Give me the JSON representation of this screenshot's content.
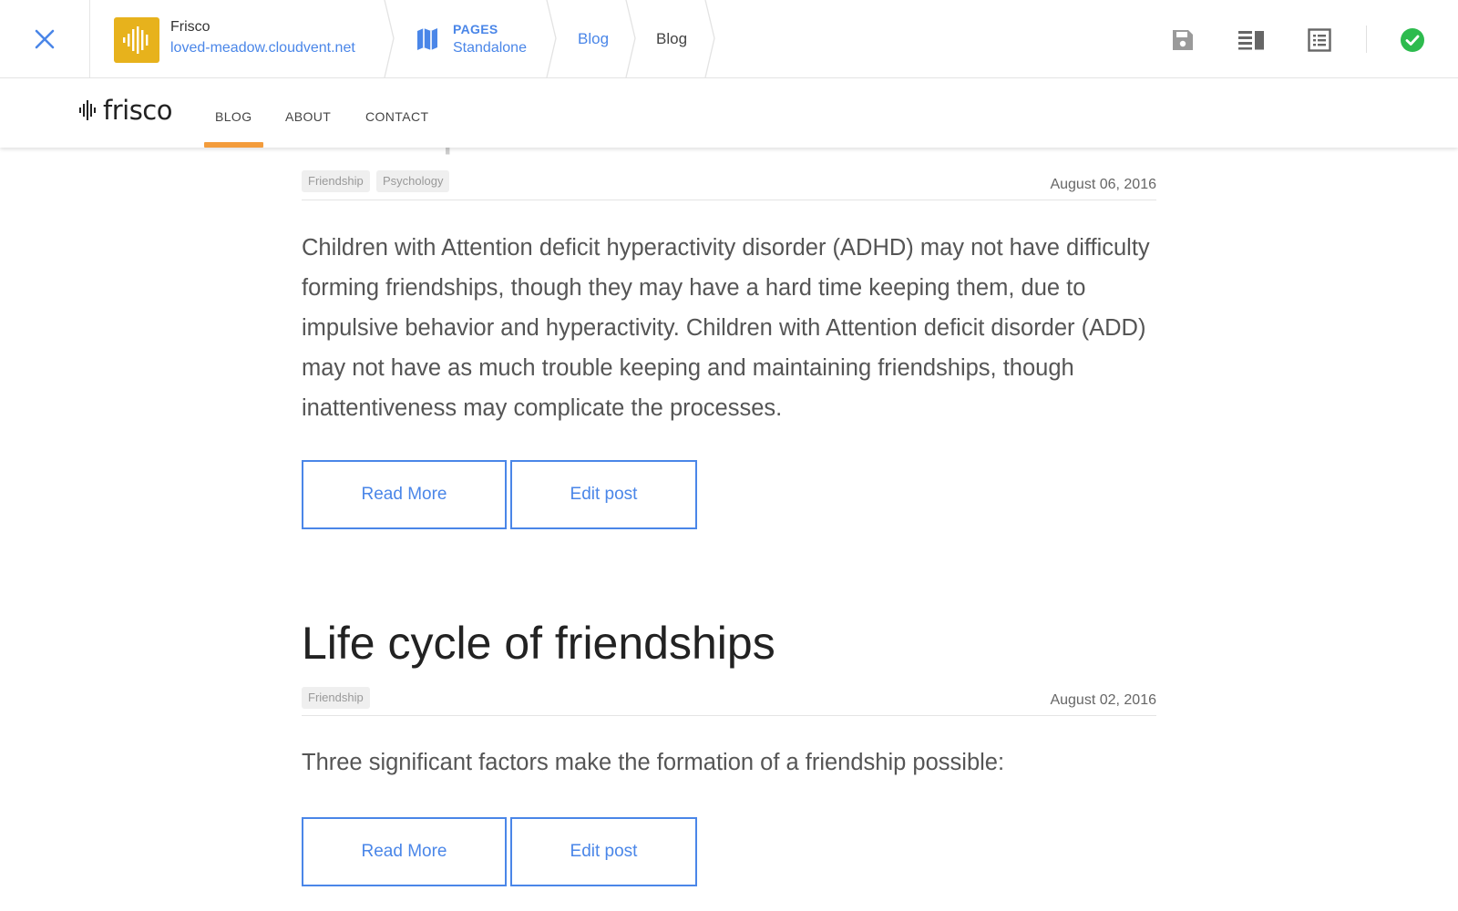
{
  "editor": {
    "site_name": "Frisco",
    "site_url": "loved-meadow.cloudvent.net",
    "pages_label": "PAGES",
    "pages_sub": "Standalone",
    "crumb_blog_link": "Blog",
    "crumb_blog_current": "Blog",
    "icons": [
      "close-icon",
      "site-logo-icon",
      "map-icon",
      "save-icon",
      "layout-icon",
      "list-icon",
      "check-circle-icon"
    ],
    "accent_color": "#4a86e8",
    "success_color": "#2dbb4e",
    "logo_color": "#e7b21c"
  },
  "site_nav": {
    "brand": "frisco",
    "items": [
      {
        "label": "BLOG"
      },
      {
        "label": "ABOUT"
      },
      {
        "label": "CONTACT"
      }
    ],
    "active_color": "#f39c3c"
  },
  "posts": [
    {
      "ghost_title": "Development Issues",
      "tags": [
        "Friendship",
        "Psychology"
      ],
      "date": "August 06, 2016",
      "body": "Children with Attention deficit hyperactivity disorder (ADHD) may not have difficulty forming friendships, though they may have a hard time keeping them, due to impulsive behavior and hyperactivity. Children with Attention deficit disorder (ADD) may not have as much trouble keeping and maintaining friendships, though inattentiveness may complicate the processes.",
      "read_more": "Read More",
      "edit_post": "Edit post"
    },
    {
      "title": "Life cycle of friendships",
      "tags": [
        "Friendship"
      ],
      "date": "August 02, 2016",
      "body": "Three significant factors make the formation of a friendship possible:",
      "read_more": "Read More",
      "edit_post": "Edit post"
    }
  ]
}
